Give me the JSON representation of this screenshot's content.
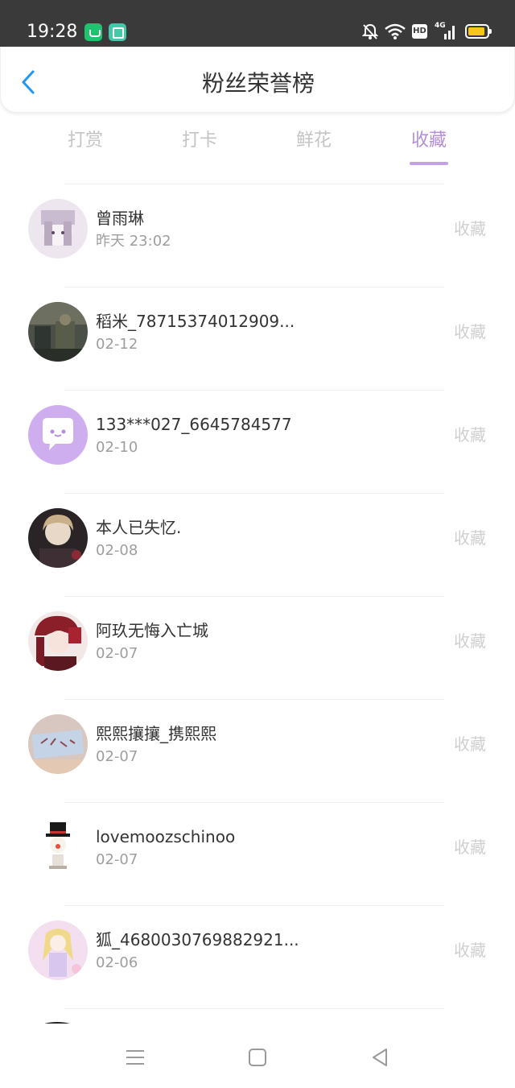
{
  "status_bar": {
    "time": "19:28",
    "hd_label": "HD",
    "network_label": "4G",
    "icons": [
      "app-green-icon",
      "app-teal-icon",
      "bell-muted-icon",
      "wifi-icon",
      "signal-icon",
      "battery-icon"
    ]
  },
  "header": {
    "title": "粉丝荣誉榜",
    "back_icon": "chevron-left-icon",
    "accent_color": "#2196f3"
  },
  "tabs": [
    {
      "label": "打赏",
      "active": false
    },
    {
      "label": "打卡",
      "active": false
    },
    {
      "label": "鲜花",
      "active": false
    },
    {
      "label": "收藏",
      "active": true
    }
  ],
  "tab_active_color": "#b48ed8",
  "fans": [
    {
      "name": "曾雨琳",
      "date": "昨天 23:02",
      "action": "收藏"
    },
    {
      "name": "稻米_78715374012909...",
      "date": "02-12",
      "action": "收藏"
    },
    {
      "name": "133***027_6645784577",
      "date": "02-10",
      "action": "收藏"
    },
    {
      "name": "本人已失忆.",
      "date": "02-08",
      "action": "收藏"
    },
    {
      "name": "阿玖无悔入亡城",
      "date": "02-07",
      "action": "收藏"
    },
    {
      "name": "熙熙攘攘_携熙熙",
      "date": "02-07",
      "action": "收藏"
    },
    {
      "name": "lovemoozschinoo",
      "date": "02-07",
      "action": "收藏"
    },
    {
      "name": "狐_4680030769882921...",
      "date": "02-06",
      "action": "收藏"
    }
  ],
  "nav_bar": {
    "icons": [
      "menu-icon",
      "home-square-icon",
      "back-triangle-icon"
    ]
  }
}
